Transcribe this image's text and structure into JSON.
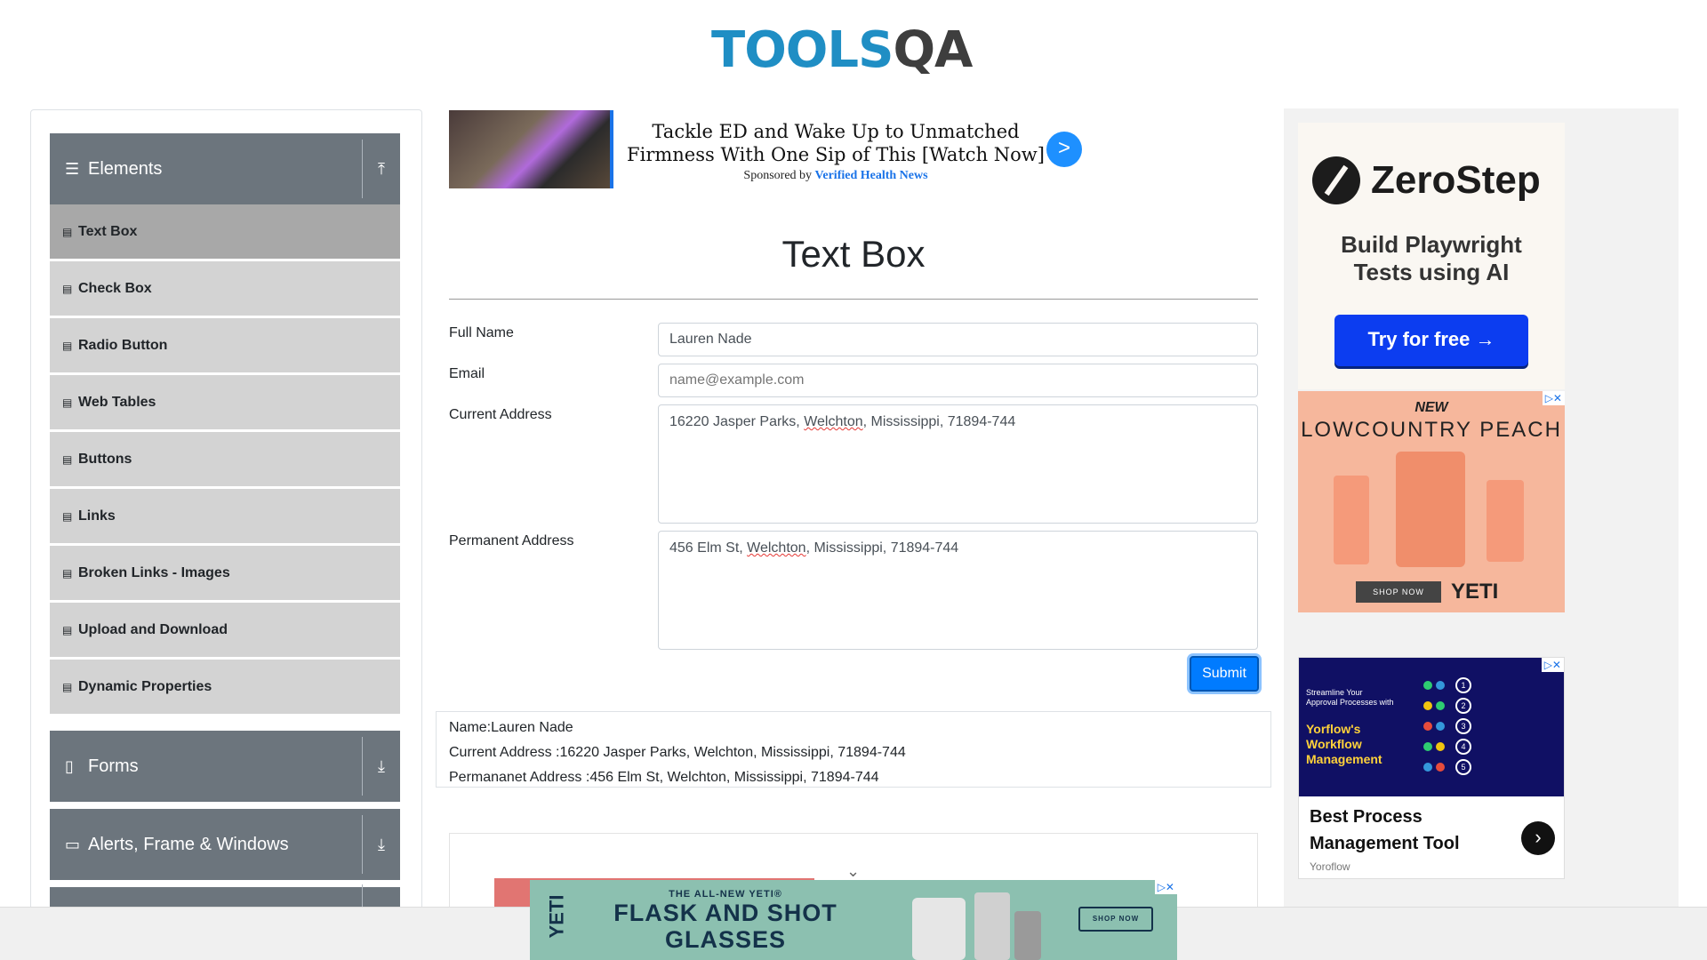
{
  "header": {
    "logo_primary": "TOOLS",
    "logo_secondary": "QA"
  },
  "sidebar": {
    "groups": [
      {
        "title": "Elements",
        "icon": "hamburger-icon",
        "arrow": "upload-arrow-icon",
        "expanded": true
      },
      {
        "title": "Forms",
        "icon": "document-icon",
        "arrow": "download-arrow-icon",
        "expanded": false
      },
      {
        "title": "Alerts, Frame & Windows",
        "icon": "window-icon",
        "arrow": "download-arrow-icon",
        "expanded": false
      }
    ],
    "items": [
      {
        "label": "Text Box",
        "active": true
      },
      {
        "label": "Check Box"
      },
      {
        "label": "Radio Button"
      },
      {
        "label": "Web Tables"
      },
      {
        "label": "Buttons"
      },
      {
        "label": "Links"
      },
      {
        "label": "Broken Links - Images"
      },
      {
        "label": "Upload and Download"
      },
      {
        "label": "Dynamic Properties"
      }
    ]
  },
  "top_ad": {
    "headline": "Tackle ED and Wake Up to Unmatched Firmness With One Sip of This [Watch Now]",
    "sponsor_prefix": "Sponsored by",
    "sponsor_name": "Verified Health News",
    "go_label": ">"
  },
  "main": {
    "title": "Text Box",
    "form": {
      "full_name_label": "Full Name",
      "full_name_value": "Lauren Nade",
      "email_label": "Email",
      "email_placeholder": "name@example.com",
      "current_address_label": "Current Address",
      "current_address_pre": "16220 Jasper Parks,",
      "current_address_misspelled": "Welchton",
      "current_address_post": ", Mississippi, 71894-744",
      "permanent_address_label": "Permanent Address",
      "permanent_address_pre": "456 Elm St,",
      "permanent_address_misspelled": "Welchton",
      "permanent_address_post": ", Mississippi, 71894-744",
      "submit_label": "Submit"
    },
    "output": {
      "name": "Name:Lauren Nade",
      "current_address": "Current Address :16220 Jasper Parks, Welchton, Mississippi, 71894-744",
      "permanent_address": "Permananet Address :456 Elm St, Welchton, Mississippi, 71894-744"
    }
  },
  "right_ads": {
    "zerostep": {
      "brand": "ZeroStep",
      "tagline_1": "Build Playwright",
      "tagline_2": "Tests using AI",
      "cta": "Try for free →"
    },
    "yeti": {
      "line1": "NEW",
      "line2": "LOWCOUNTRY PEACH",
      "shop": "SHOP NOW",
      "brand": "YETI"
    },
    "workflow": {
      "banner_line1": "Streamline Your",
      "banner_line2": "Approval Processes with",
      "banner_title_1": "Yorflow's",
      "banner_title_2": "Workflow",
      "banner_title_3": "Management",
      "title_1": "Best Process",
      "title_2": "Management Tool",
      "source": "Yoroflow",
      "next": "›"
    }
  },
  "sticky_ad": {
    "brand": "YETI",
    "kicker": "THE ALL-NEW YETI®",
    "headline_1": "FLASK AND SHOT",
    "headline_2": "GLASSES",
    "cta": "SHOP NOW"
  },
  "ad_choices": "▷✕"
}
